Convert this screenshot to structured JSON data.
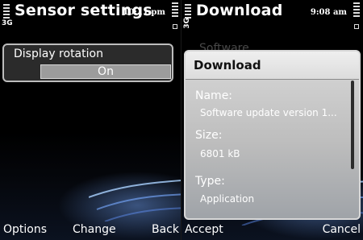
{
  "left_screen": {
    "title": "Sensor settings",
    "time": "10:11 pm",
    "network": "3G",
    "setting": {
      "label": "Display rotation",
      "value": "On"
    },
    "softkeys": {
      "left": "Options",
      "middle": "Change",
      "right": "Back"
    }
  },
  "right_screen": {
    "title": "Download",
    "time": "9:08 am",
    "network": "3G",
    "background_hint": "Software ...",
    "dialog": {
      "title": "Download",
      "fields": [
        {
          "label": "Name:",
          "value": "Software update version 1..."
        },
        {
          "label": "Size:",
          "value": "6801 kB"
        },
        {
          "label": "Type:",
          "value": "Application"
        }
      ]
    },
    "softkeys": {
      "left": "Accept",
      "right": "Cancel"
    }
  }
}
